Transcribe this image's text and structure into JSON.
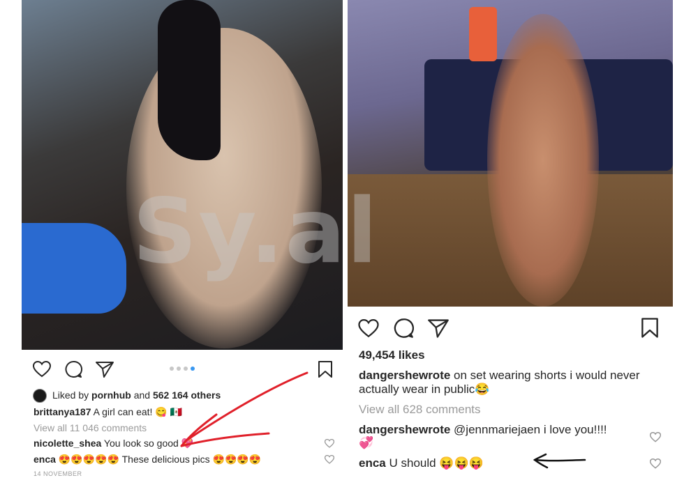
{
  "watermark": "Sy.al",
  "left_post": {
    "liked_by_prefix": "Liked by",
    "liked_by_user": "pornhub",
    "liked_by_and": "and",
    "liked_by_others": "562 164 others",
    "caption_user": "brittanya187",
    "caption_text": "A girl can eat! 😋 🇲🇽",
    "view_comments": "View all 11 046 comments",
    "comments": [
      {
        "user": "nicolette_shea",
        "text": "You look so good 💖"
      },
      {
        "user": "enca",
        "text": "😍😍😍😍😍 These delicious pics 😍😍😍😍"
      }
    ],
    "date": "14 NOVEMBER",
    "carousel": {
      "count": 4,
      "active_index": 3
    },
    "accent_color": "#3897f0"
  },
  "right_post": {
    "likes": "49,454 likes",
    "caption_user": "dangershewrote",
    "caption_text_line1": "on set wearing shorts i would never",
    "caption_text_line2": "actually wear in public😂",
    "view_comments": "View all 628 comments",
    "comments": [
      {
        "user": "dangershewrote",
        "text_line1": "@jennmariejaen i love you!!!!",
        "text_line2": "💞"
      },
      {
        "user": "enca",
        "text": "U should 😝😝😝"
      }
    ]
  },
  "annotations": {
    "arrow_color": "#e0202a",
    "pen_color": "#111111"
  }
}
